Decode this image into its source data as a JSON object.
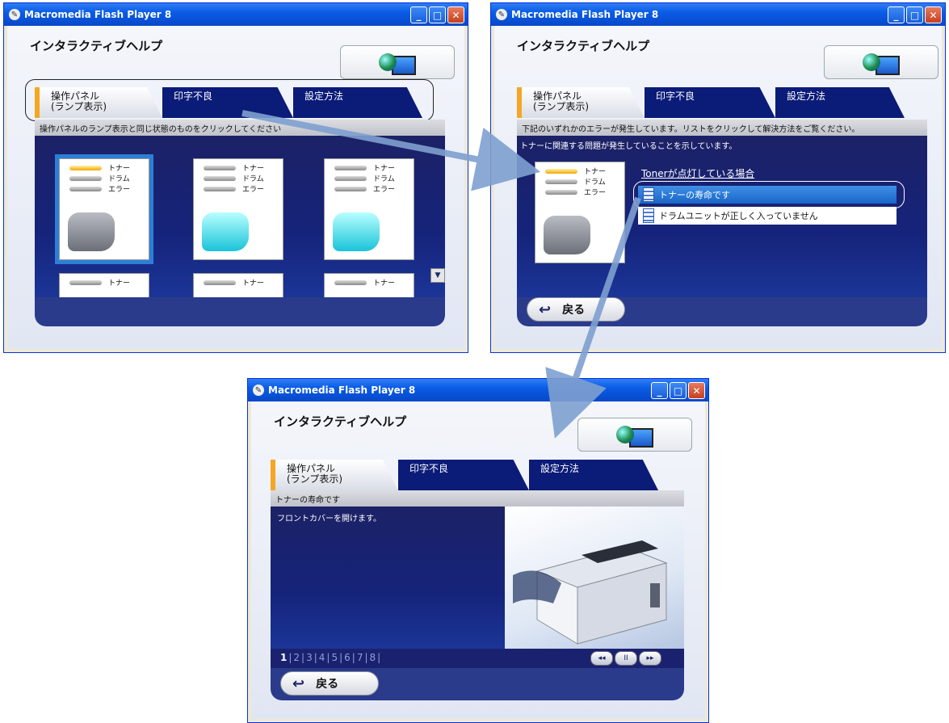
{
  "window_title": "Macromedia Flash Player 8",
  "app_title": "インタラクティブヘルプ",
  "tabs": [
    {
      "label_l1": "操作パネル",
      "label_l2": "(ランプ表示)"
    },
    {
      "label_l1": "印字不良",
      "label_l2": ""
    },
    {
      "label_l1": "設定方法",
      "label_l2": ""
    }
  ],
  "win1": {
    "info": "操作パネルのランプ表示と同じ状態のものをクリックしてください"
  },
  "lamp_labels": [
    "トナー",
    "ドラム",
    "エラー"
  ],
  "win2": {
    "info": "下記のいずれかのエラーが発生しています。リストをクリックして解決方法をご覧ください。",
    "subtext": "トナーに関連する問題が発生していることを示しています。",
    "list_heading": "Tonerが点灯している場合",
    "items": [
      "トナーの寿命です",
      "ドラムユニットが正しく入っていません"
    ],
    "back": "戻る"
  },
  "win3": {
    "info": "トナーの寿命です",
    "instruction": "フロントカバーを開けます。",
    "pages": [
      "1",
      "2",
      "3",
      "4",
      "5",
      "6",
      "7",
      "8"
    ],
    "back": "戻る",
    "controls": [
      "◂◂",
      "II",
      "▸▸"
    ]
  }
}
